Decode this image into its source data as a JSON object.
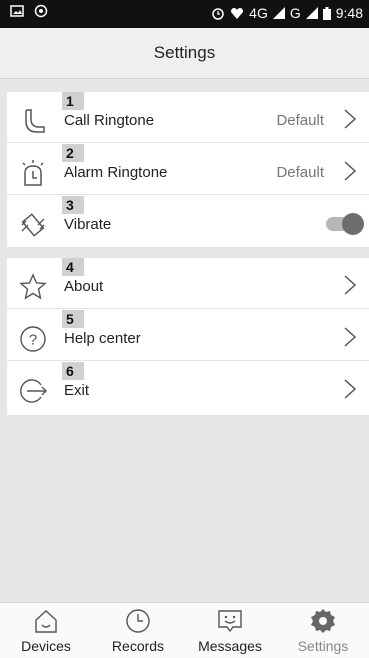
{
  "status_bar": {
    "time": "9:48",
    "network_1": "4G",
    "network_2": "G"
  },
  "header": {
    "title": "Settings"
  },
  "groups": [
    {
      "items": [
        {
          "badge": "1",
          "label": "Call Ringtone",
          "value": "Default",
          "icon": "phone-icon"
        },
        {
          "badge": "2",
          "label": "Alarm Ringtone",
          "value": "Default",
          "icon": "alarm-clock-icon"
        },
        {
          "badge": "3",
          "label": "Vibrate",
          "icon": "vibrate-icon",
          "toggle_on": true
        }
      ]
    },
    {
      "items": [
        {
          "badge": "4",
          "label": "About",
          "icon": "star-icon"
        },
        {
          "badge": "5",
          "label": "Help center",
          "icon": "question-icon"
        },
        {
          "badge": "6",
          "label": "Exit",
          "icon": "exit-icon"
        }
      ]
    }
  ],
  "tabs": [
    {
      "label": "Devices",
      "icon": "home-icon",
      "active": false
    },
    {
      "label": "Records",
      "icon": "clock-icon",
      "active": false
    },
    {
      "label": "Messages",
      "icon": "message-icon",
      "active": false
    },
    {
      "label": "Settings",
      "icon": "gear-icon",
      "active": true
    }
  ],
  "colors": {
    "background": "#e6e6e6",
    "status_bar": "#111111",
    "card": "#ffffff",
    "toggle_thumb": "#6e6e6e"
  }
}
